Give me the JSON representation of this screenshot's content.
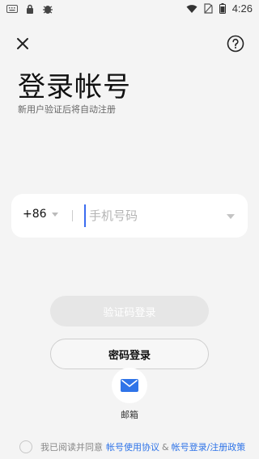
{
  "status_bar": {
    "time": "4:26",
    "icons": [
      "keyboard-icon",
      "lock-icon",
      "bug-icon",
      "wifi-icon",
      "no-sim-icon",
      "battery-icon"
    ]
  },
  "header": {
    "close_icon": "close-icon",
    "help_icon": "help-icon"
  },
  "title": "登录帐号",
  "subtitle": "新用户验证后将自动注册",
  "phone": {
    "country_code": "+86",
    "placeholder": "手机号码",
    "value": ""
  },
  "buttons": {
    "code_login": "验证码登录",
    "password_login": "密码登录"
  },
  "email": {
    "label": "邮箱",
    "icon": "envelope-icon"
  },
  "agreement": {
    "prefix": "我已阅读并同意",
    "link1": "帐号使用协议",
    "amp": "&",
    "link2": "帐号登录/注册政策"
  },
  "colors": {
    "background": "#f4f4f4",
    "accent": "#2f74e8",
    "disabled_button": "#e6e6e6"
  }
}
